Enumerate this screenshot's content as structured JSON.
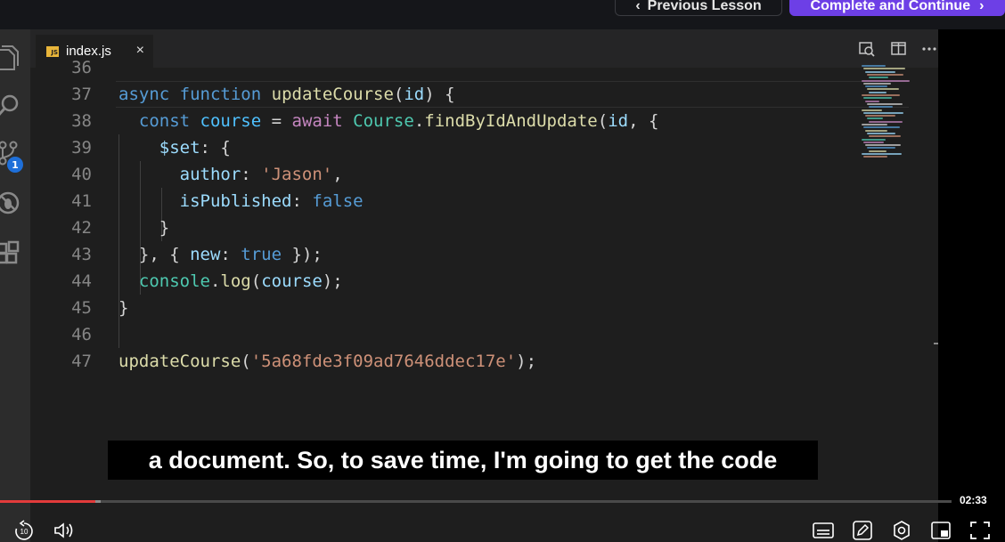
{
  "header": {
    "prev_label": "Previous Lesson",
    "complete_label": "Complete and Continue",
    "complete_color": "#6d3fe6"
  },
  "editor": {
    "tab": {
      "filename": "index.js",
      "icon": "js-file-icon",
      "close": "×"
    },
    "scm_badge": "1",
    "lines": [
      {
        "n": "36",
        "tokens": []
      },
      {
        "n": "37",
        "tokens": [
          [
            "kw",
            "async"
          ],
          [
            "pn",
            " "
          ],
          [
            "kw",
            "function"
          ],
          [
            "pn",
            " "
          ],
          [
            "fn",
            "updateCourse"
          ],
          [
            "pn",
            "("
          ],
          [
            "var",
            "id"
          ],
          [
            "pn",
            ") {"
          ]
        ]
      },
      {
        "n": "38",
        "tokens": [
          [
            "pn",
            "  "
          ],
          [
            "kw",
            "const"
          ],
          [
            "pn",
            " "
          ],
          [
            "cn",
            "course"
          ],
          [
            "pn",
            " = "
          ],
          [
            "ctl",
            "await"
          ],
          [
            "pn",
            " "
          ],
          [
            "cls",
            "Course"
          ],
          [
            "pn",
            "."
          ],
          [
            "fn",
            "findByIdAndUpdate"
          ],
          [
            "pn",
            "("
          ],
          [
            "var",
            "id"
          ],
          [
            "pn",
            ", {"
          ]
        ]
      },
      {
        "n": "39",
        "tokens": [
          [
            "pn",
            "    "
          ],
          [
            "var",
            "$set"
          ],
          [
            "pn",
            ": {"
          ]
        ]
      },
      {
        "n": "40",
        "tokens": [
          [
            "pn",
            "      "
          ],
          [
            "var",
            "author"
          ],
          [
            "pn",
            ": "
          ],
          [
            "str",
            "'Jason'"
          ],
          [
            "pn",
            ","
          ]
        ]
      },
      {
        "n": "41",
        "tokens": [
          [
            "pn",
            "      "
          ],
          [
            "var",
            "isPublished"
          ],
          [
            "pn",
            ": "
          ],
          [
            "kw",
            "false"
          ]
        ]
      },
      {
        "n": "42",
        "tokens": [
          [
            "pn",
            "    }"
          ]
        ]
      },
      {
        "n": "43",
        "tokens": [
          [
            "pn",
            "  }, { "
          ],
          [
            "var",
            "new"
          ],
          [
            "pn",
            ": "
          ],
          [
            "kw",
            "true"
          ],
          [
            "pn",
            " });"
          ]
        ]
      },
      {
        "n": "44",
        "tokens": [
          [
            "pn",
            "  "
          ],
          [
            "cls",
            "console"
          ],
          [
            "pn",
            "."
          ],
          [
            "fn",
            "log"
          ],
          [
            "pn",
            "("
          ],
          [
            "var",
            "course"
          ],
          [
            "pn",
            ");"
          ]
        ]
      },
      {
        "n": "45",
        "tokens": [
          [
            "pn",
            "}"
          ]
        ]
      },
      {
        "n": "46",
        "tokens": []
      },
      {
        "n": "47",
        "tokens": [
          [
            "fn",
            "updateCourse"
          ],
          [
            "pn",
            "("
          ],
          [
            "str",
            "'5a68fde3f09ad7646ddec17e'"
          ],
          [
            "pn",
            ");"
          ]
        ]
      }
    ]
  },
  "subtitle": "a document. So, to save time, I'm going to get the code",
  "player": {
    "time": "02:33",
    "progress": 0.1,
    "buffered": 0.106,
    "rewind_seconds": "10",
    "controls": [
      "rewind-10-icon",
      "volume-icon",
      "captions-icon",
      "notes-icon",
      "settings-icon",
      "picture-in-picture-icon",
      "fullscreen-icon"
    ]
  }
}
